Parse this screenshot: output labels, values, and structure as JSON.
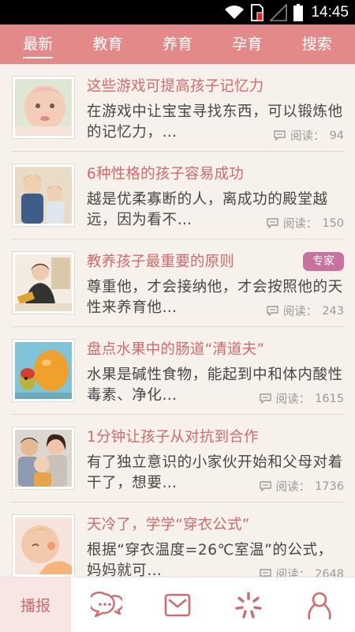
{
  "status_bar": {
    "time": "14:45",
    "icons": [
      "wifi-icon",
      "sim-alert-icon",
      "signal-icon",
      "battery-icon"
    ]
  },
  "top_nav": {
    "tabs": [
      {
        "label": "最新",
        "active": true
      },
      {
        "label": "教育",
        "active": false
      },
      {
        "label": "养育",
        "active": false
      },
      {
        "label": "孕育",
        "active": false
      },
      {
        "label": "搜索",
        "active": false
      }
    ]
  },
  "articles": [
    {
      "title": "这些游戏可提高孩子记忆力",
      "summary": "在游戏中让宝宝寻找东西，可以锻炼他的记忆力，…",
      "reads_label": "阅读：",
      "reads": "94",
      "badge": ""
    },
    {
      "title": "6种性格的孩子容易成功",
      "summary": "越是优柔寡断的人，离成功的殿堂越远，因为看不…",
      "reads_label": "阅读：",
      "reads": "150",
      "badge": ""
    },
    {
      "title": "教养孩子最重要的原则",
      "summary": "尊重他，才会接纳他，才会按照他的天性来养育他…",
      "reads_label": "阅读：",
      "reads": "243",
      "badge": "专家"
    },
    {
      "title": "盘点水果中的肠道“清道夫”",
      "summary": "水果是碱性食物，能起到中和体内酸性毒素、净化…",
      "reads_label": "阅读：",
      "reads": "1615",
      "badge": ""
    },
    {
      "title": "1分钟让孩子从对抗到合作",
      "summary": "有了独立意识的小家伙开始和父母对着干了，想要…",
      "reads_label": "阅读：",
      "reads": "1736",
      "badge": ""
    },
    {
      "title": "天冷了，学学“穿衣公式”",
      "summary": "根据“穿衣温度=26℃室温”的公式，妈妈就可…",
      "reads_label": "阅读：",
      "reads": "2648",
      "badge": ""
    }
  ],
  "bottom_nav": {
    "items": [
      {
        "label": "播报",
        "icon": "broadcast",
        "active": true
      },
      {
        "label": "",
        "icon": "chat-bubbles-icon",
        "active": false
      },
      {
        "label": "",
        "icon": "mail-icon",
        "active": false
      },
      {
        "label": "",
        "icon": "discover-icon",
        "active": false
      },
      {
        "label": "",
        "icon": "profile-icon",
        "active": false
      }
    ]
  },
  "colors": {
    "accent": "#e48989",
    "title": "#d06b6b",
    "background": "#f6f1ea",
    "badge": "#c8739f"
  }
}
